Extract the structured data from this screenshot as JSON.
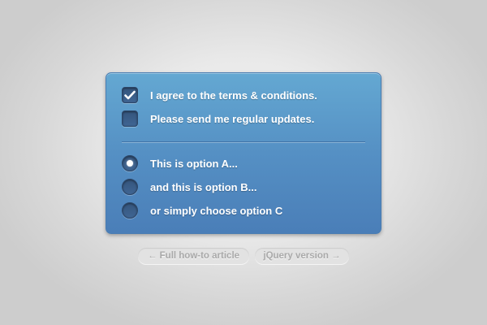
{
  "form": {
    "checkboxes": [
      {
        "label": "I agree to the terms & conditions.",
        "checked": true
      },
      {
        "label": "Please send me regular updates.",
        "checked": false
      }
    ],
    "radios": [
      {
        "label": "This is option A...",
        "selected": true
      },
      {
        "label": "and this is option B...",
        "selected": false
      },
      {
        "label": "or simply choose option C",
        "selected": false
      }
    ]
  },
  "links": {
    "article": "← Full how-to article",
    "jquery": "jQuery version →"
  },
  "colors": {
    "panel_top": "#64a8d2",
    "panel_bottom": "#4a7eb8",
    "control_fill": "#3a5d88",
    "text": "#ffffff",
    "link_text": "#a9a9a9",
    "link_bg": "#e2e2e2"
  },
  "icons": {
    "checked_mark": "checkmark-icon",
    "radio_selected": "radio-dot-icon"
  }
}
